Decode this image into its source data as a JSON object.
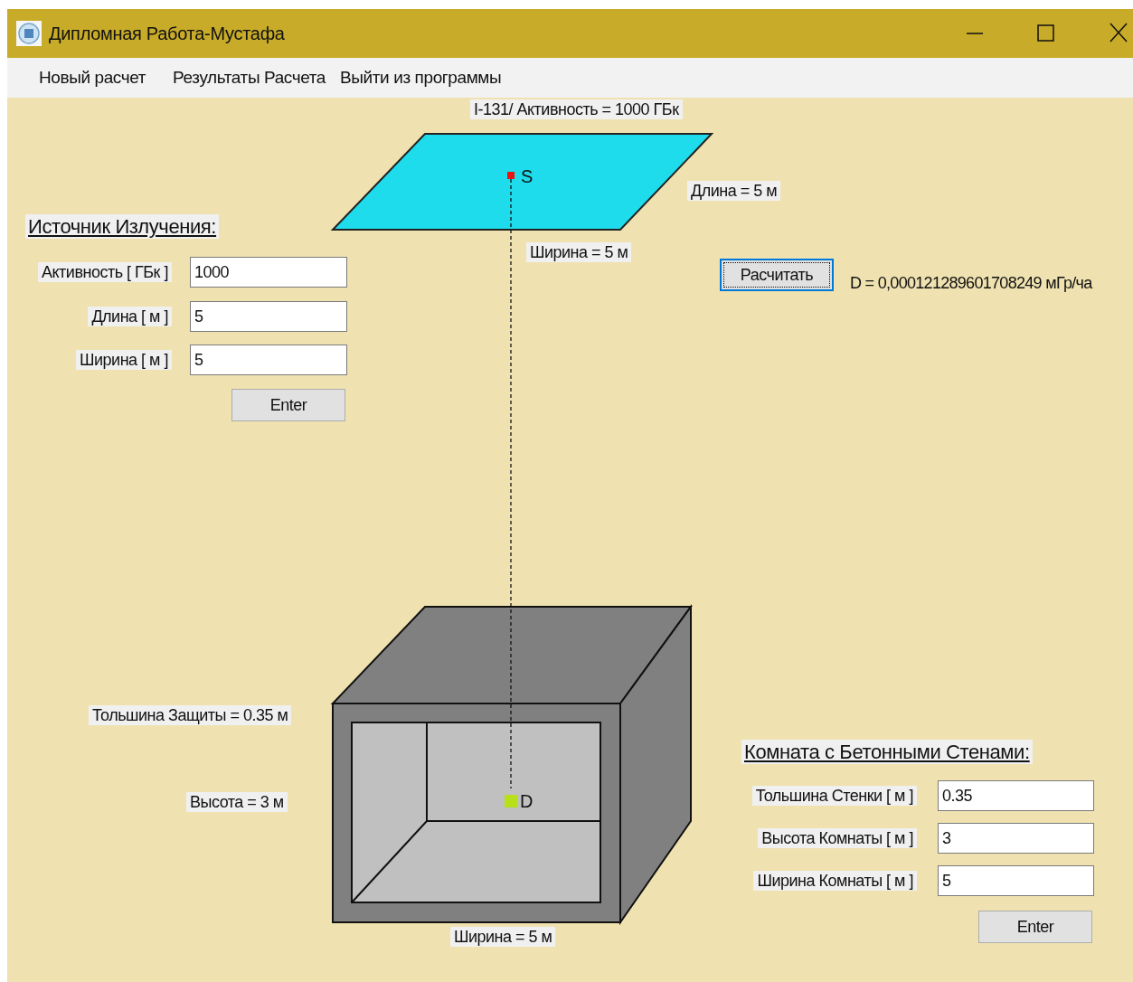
{
  "window": {
    "title": "Дипломная Работа-Мустафа"
  },
  "menu": [
    {
      "label": "Новый расчет"
    },
    {
      "label": "Результаты Расчета"
    },
    {
      "label": "Выйти из программы"
    }
  ],
  "diagram": {
    "source_label": "I-131/ Активность = 1000 ГБк",
    "source_point": "S",
    "length_label": "Длина = 5 м",
    "width_label": "Ширина = 5 м",
    "detector_point": "D",
    "thickness_label": "Тольшина Защиты = 0.35 м",
    "height_label": "Высота = 3 м",
    "room_width_label": "Ширина = 5 м"
  },
  "source_panel": {
    "title": "Источник Излучения:",
    "fields": [
      {
        "label": "Активность [ ГБк ]",
        "value": "1000"
      },
      {
        "label": "Длина [ м ]",
        "value": "5"
      },
      {
        "label": "Ширина [ м ]",
        "value": "5"
      }
    ],
    "button": "Enter"
  },
  "calculate": {
    "button": "Расчитать",
    "result": "D = 0,000121289601708249 мГр/ча"
  },
  "room_panel": {
    "title": "Комната с Бетонными Стенами:",
    "fields": [
      {
        "label": "Тольшина Стенки [ м ]",
        "value": "0.35"
      },
      {
        "label": "Высота Комнаты [ м ]",
        "value": "3"
      },
      {
        "label": "Ширина Комнаты [ м ]",
        "value": "5"
      }
    ],
    "button": "Enter"
  }
}
